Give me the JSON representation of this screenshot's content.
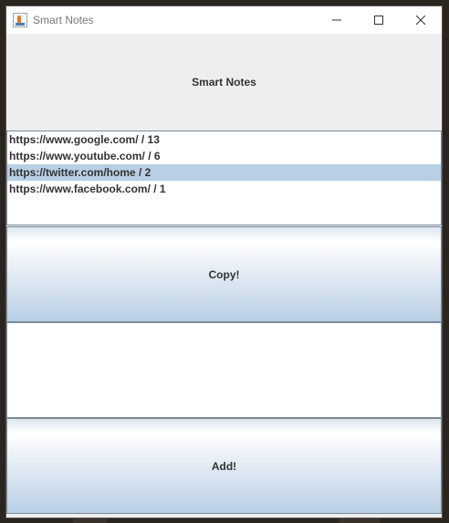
{
  "window": {
    "title": "Smart Notes"
  },
  "header": {
    "label": "Smart Notes"
  },
  "list": {
    "items": [
      "https://www.google.com/ / 13",
      "https://www.youtube.com/ / 6",
      "https://twitter.com/home / 2",
      "https://www.facebook.com/ / 1"
    ],
    "selected_index": 2
  },
  "buttons": {
    "copy_label": "Copy!",
    "add_label": "Add!"
  },
  "text_area": {
    "value": ""
  },
  "colors": {
    "selection": "#b8cfe5",
    "text": "#333333"
  }
}
